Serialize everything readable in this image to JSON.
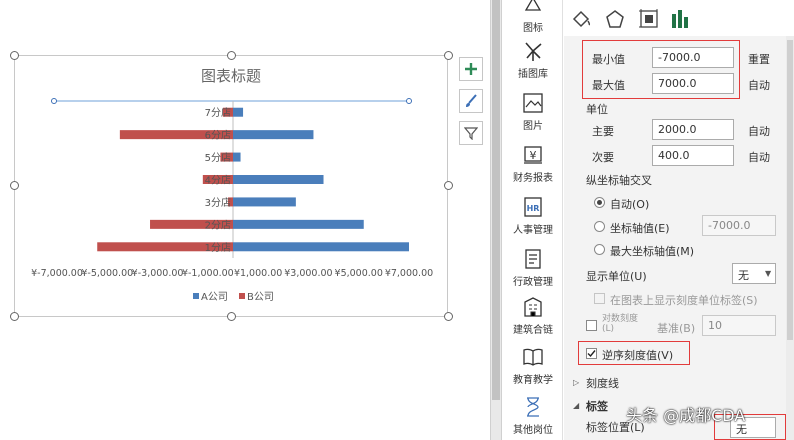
{
  "chart_data": {
    "type": "bar",
    "orientation": "horizontal",
    "title": "图表标题",
    "categories": [
      "7分店",
      "6分店",
      "5分店",
      "4分店",
      "3分店",
      "2分店",
      "1分店"
    ],
    "series": [
      {
        "name": "A公司",
        "color": "#4a7ebb",
        "values": [
          400,
          3200,
          300,
          3600,
          2500,
          5200,
          7000
        ]
      },
      {
        "name": "B公司",
        "color": "#c0504d",
        "values": [
          -400,
          -4500,
          -500,
          -1200,
          -200,
          -3300,
          -5400
        ]
      }
    ],
    "xlim": [
      -7000,
      7000
    ],
    "x_ticks": [
      "¥-7,000.00",
      "¥-5,000.00",
      "¥-3,000.00",
      "¥-1,000.00",
      "¥1,000.00",
      "¥3,000.00",
      "¥5,000.00",
      "¥7,000.00"
    ],
    "legend_position": "bottom",
    "grid": false
  },
  "chart_side_buttons": [
    {
      "icon": "plus-icon"
    },
    {
      "icon": "brush-icon"
    },
    {
      "icon": "filter-icon"
    }
  ],
  "rail": {
    "items": [
      {
        "label": "图标",
        "icon": "shapes-icon"
      },
      {
        "label": "插图库",
        "icon": "windmill-icon"
      },
      {
        "label": "图片",
        "icon": "picture-icon"
      },
      {
        "label": "财务报表",
        "icon": "finance-icon"
      },
      {
        "label": "人事管理",
        "icon": "hr-icon"
      },
      {
        "label": "行政管理",
        "icon": "admin-icon"
      },
      {
        "label": "建筑合链",
        "icon": "building-icon"
      },
      {
        "label": "教育教学",
        "icon": "book-icon"
      },
      {
        "label": "其他岗位",
        "icon": "hourglass-icon"
      }
    ]
  },
  "panel": {
    "tabs": [
      {
        "icon": "fill-icon"
      },
      {
        "icon": "pentagon-icon"
      },
      {
        "icon": "size-icon"
      },
      {
        "icon": "bar-chart-icon"
      }
    ],
    "min_label": "最小值",
    "min_value": "-7000.0",
    "min_action": "重置",
    "max_label": "最大值",
    "max_value": "7000.0",
    "max_action": "自动",
    "unit_header": "单位",
    "major_label": "主要",
    "major_value": "2000.0",
    "major_action": "自动",
    "minor_label": "次要",
    "minor_value": "400.0",
    "minor_action": "自动",
    "cross_header": "纵坐标轴交叉",
    "cross_auto": "自动(O)",
    "cross_value_label": "坐标轴值(E)",
    "cross_value": "-7000.0",
    "cross_max": "最大坐标轴值(M)",
    "display_units_label": "显示单位(U)",
    "display_units_value": "无",
    "show_units_label": "在图表上显示刻度单位标签(S)",
    "log_label": "对数刻度(L)",
    "base_label": "基准(B)",
    "base_value": "10",
    "reverse_label": "逆序刻度值(V)",
    "tick_section": "刻度线",
    "label_section": "标签",
    "label_pos_label": "标签位置(L)",
    "label_pos_value": "无"
  },
  "watermark": "头条 @成都CDA"
}
